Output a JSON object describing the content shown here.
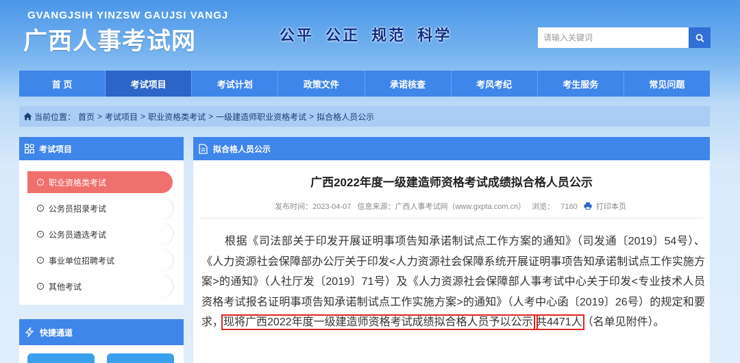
{
  "header": {
    "logo_en": "GVANGJSIH YINZSW GAUJSI VANGJ",
    "logo_cn": "广西人事考试网",
    "slogan": "公平 公正 规范 科学",
    "search_placeholder": "请输入关键词",
    "search_icon": "search-icon"
  },
  "nav": {
    "items": [
      "首 页",
      "考试项目",
      "考试计划",
      "政策文件",
      "承诺核查",
      "考风考纪",
      "考生服务",
      "常见问题"
    ],
    "active_index": 1
  },
  "breadcrumb": {
    "label": "当前位置：",
    "items": [
      "首页",
      "考试项目",
      "职业资格类考试",
      "一级建造师职业资格考试",
      "拟合格人员公示"
    ],
    "separator": ">"
  },
  "sidebar": {
    "title": "考试项目",
    "items": [
      "职业资格类考试",
      "公务员招录考试",
      "公务员遴选考试",
      "事业单位招聘考试",
      "其他考试"
    ],
    "active_index": 0,
    "quick_title": "快捷通道"
  },
  "main": {
    "section_title": "拟合格人员公示",
    "article_title": "广西2022年度一级建造师资格考试成绩拟合格人员公示",
    "meta": {
      "publish": "发布时间：2023-04-07",
      "source": "信息来源：广西人事考试网（www.gxpta.com.cn）",
      "views_label": "浏览：",
      "views": "7160",
      "print": "打印本页"
    },
    "paragraph": {
      "part1": "根据《司法部关于印发开展证明事项告知承诺制试点工作方案的通知》（司发通〔2019〕54号）、《人力资源社会保障部办公厅关于印发<人力资源社会保障系统开展证明事项告知承诺制试点工作实施方案>的通知》（人社厅发〔2019〕71号）及《人力资源社会保障部人事考试中心关于印发<专业技术人员资格考试报名证明事项告知承诺制试点工作实施方案>的通知》（人考中心函〔2019〕26号）的规定和要求，",
      "highlight1": "现将广西2022年度一级建造师资格考试成绩拟合格人员予以公示,",
      "highlight2": "共4471人",
      "part2": "（名单见附件）。"
    }
  },
  "colors": {
    "primary": "#3e86ea",
    "active_nav": "#2b65c7",
    "active_side": "#f0706e",
    "highlight": "#e0241f"
  }
}
